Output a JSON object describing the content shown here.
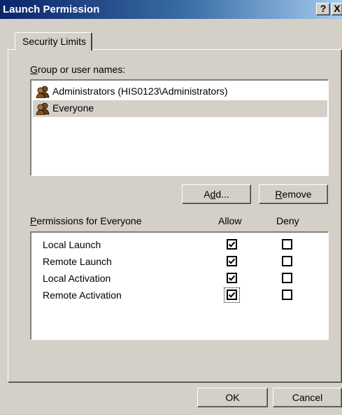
{
  "window": {
    "title": "Launch Permission",
    "help_label": "?",
    "close_label": "X"
  },
  "tabs": [
    {
      "label": "Security Limits"
    }
  ],
  "group_label_first": "G",
  "group_label_rest": "roup or user names:",
  "users": [
    {
      "name": "Administrators (HIS0123\\Administrators)",
      "icon": "user-group-icon",
      "selected": false
    },
    {
      "name": "Everyone",
      "icon": "user-group-icon",
      "selected": true
    }
  ],
  "buttons": {
    "add_pre": "A",
    "add_ul": "d",
    "add_post": "d...",
    "remove_ul": "R",
    "remove_post": "emove",
    "ok": "OK",
    "cancel": "Cancel"
  },
  "permissions": {
    "title_ul": "P",
    "title_rest": "ermissions for Everyone",
    "allow_header": "Allow",
    "deny_header": "Deny",
    "rows": [
      {
        "name": "Local Launch",
        "allow": true,
        "deny": false
      },
      {
        "name": "Remote Launch",
        "allow": true,
        "deny": false
      },
      {
        "name": "Local Activation",
        "allow": true,
        "deny": false
      },
      {
        "name": "Remote Activation",
        "allow": true,
        "deny": false
      }
    ]
  }
}
